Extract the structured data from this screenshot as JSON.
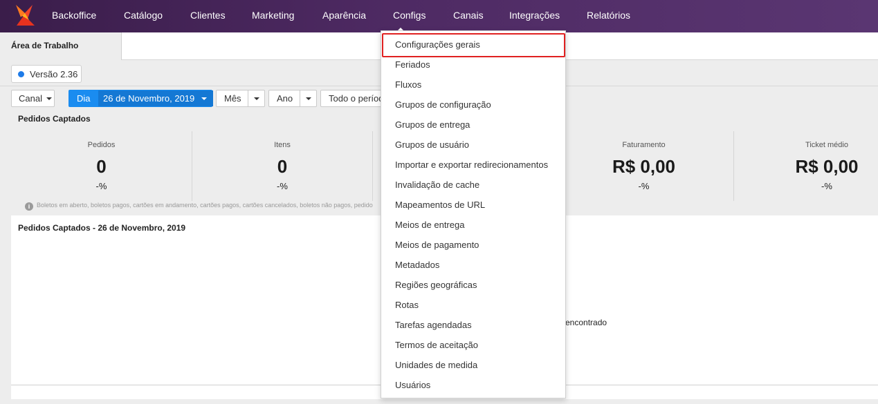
{
  "nav": {
    "items": [
      "Backoffice",
      "Catálogo",
      "Clientes",
      "Marketing",
      "Aparência",
      "Configs",
      "Canais",
      "Integrações",
      "Relatórios"
    ],
    "active": "Configs",
    "bg": "#4a2560"
  },
  "tabs": {
    "active_label": "Área de Trabalho"
  },
  "version": {
    "label": "Versão 2.36",
    "dot_color": "#1e7be8"
  },
  "filters": {
    "channel_label": "Canal",
    "day_label": "Dia",
    "date_value": "26 de Novembro, 2019",
    "month_label": "Mês",
    "year_label": "Ano",
    "period_label": "Todo o período"
  },
  "summary": {
    "title": "Pedidos Captados",
    "stats": [
      {
        "label": "Pedidos",
        "value": "0",
        "pct": "-%"
      },
      {
        "label": "Itens",
        "value": "0",
        "pct": "-%"
      },
      {
        "label": "Faturamento",
        "value": "R$ 0,00",
        "pct": "-%"
      },
      {
        "label": "Ticket médio",
        "value": "R$ 0,00",
        "pct": "-%"
      }
    ],
    "info_note": "Boletos em aberto, boletos pagos, cartões em andamento, cartões pagos, cartões cancelados, boletos não pagos, pedido"
  },
  "chart_panel": {
    "title": "Pedidos Captados - 26 de Novembro, 2019",
    "empty_text": "encontrado"
  },
  "configs_menu": {
    "items": [
      "Configurações gerais",
      "Feriados",
      "Fluxos",
      "Grupos de configuração",
      "Grupos de entrega",
      "Grupos de usuário",
      "Importar e exportar redirecionamentos",
      "Invalidação de cache",
      "Mapeamentos de URL",
      "Meios de entrega",
      "Meios de pagamento",
      "Metadados",
      "Regiões geográficas",
      "Rotas",
      "Tarefas agendadas",
      "Termos de aceitação",
      "Unidades de medida",
      "Usuários"
    ],
    "highlighted": "Configurações gerais",
    "highlight_color": "#e02020"
  },
  "colors": {
    "accent": "#1a8cf0",
    "brand_orange": "#f05a28"
  }
}
